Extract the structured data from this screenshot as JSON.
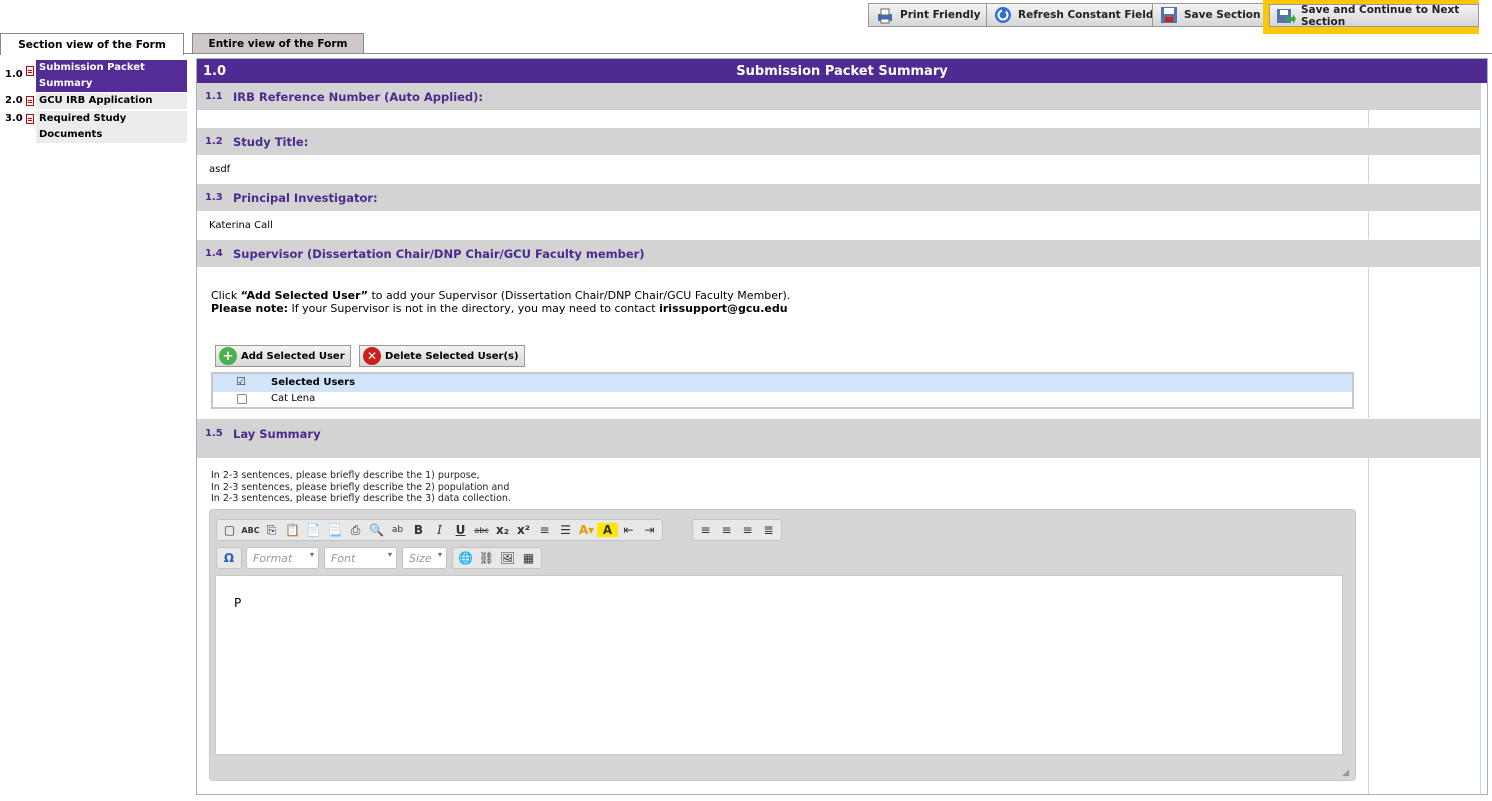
{
  "toolbar": {
    "print_label": "Print Friendly",
    "refresh_label": "Refresh Constant Fields",
    "save_label": "Save Section",
    "save_next_label": "Save and Continue to Next Section"
  },
  "tabs": {
    "section_view": "Section view of the Form",
    "entire_view": "Entire view of the Form"
  },
  "nav": [
    {
      "num": "1.0",
      "label": "Submission Packet Summary"
    },
    {
      "num": "2.0",
      "label": "GCU IRB Application"
    },
    {
      "num": "3.0",
      "label": "Required Study Documents"
    }
  ],
  "section": {
    "num": "1.0",
    "title": "Submission Packet Summary"
  },
  "questions": [
    {
      "num": "1.1",
      "label": "IRB Reference Number (Auto Applied):",
      "value": ""
    },
    {
      "num": "1.2",
      "label": "Study Title:",
      "value": "asdf"
    },
    {
      "num": "1.3",
      "label": "Principal Investigator:",
      "value": "Katerina Call"
    },
    {
      "num": "1.4",
      "label": "Supervisor (Dissertation Chair/DNP Chair/GCU Faculty member)"
    },
    {
      "num": "1.5",
      "label": "Lay Summary"
    }
  ],
  "supervisor": {
    "instr_click": "Click ",
    "instr_button_name": "“Add Selected User”",
    "instr_rest": " to add your Supervisor (Dissertation Chair/DNP Chair/GCU Faculty Member).",
    "note_label": "Please note:",
    "note_text": " If your Supervisor is not in the directory, you may need to contact ",
    "email": "irissupport@gcu.edu",
    "add_button": "Add Selected User",
    "delete_button": "Delete Selected User(s)",
    "table_header": "Selected Users",
    "users": [
      "Cat Lena"
    ]
  },
  "lay_summary": {
    "instructions": [
      "In 2-3 sentences, please briefly describe the 1) purpose,",
      "In 2-3 sentences, please briefly describe the 2) population and",
      "In 2-3 sentences, please briefly describe the 3) data collection."
    ],
    "format_placeholder": "Format",
    "font_placeholder": "Font",
    "size_placeholder": "Size",
    "editor_content": "P"
  },
  "colors": {
    "section_header": "#4f2a93",
    "question_text": "#4b2a90",
    "highlight": "#ffc60a"
  }
}
